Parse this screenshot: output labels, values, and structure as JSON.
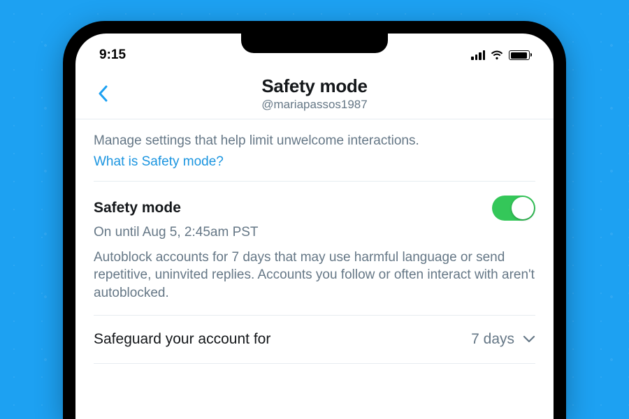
{
  "statusBar": {
    "time": "9:15"
  },
  "header": {
    "title": "Safety mode",
    "handle": "@mariapassos1987"
  },
  "intro": {
    "text": "Manage settings that help limit unwelcome interactions.",
    "link": "What is Safety mode?"
  },
  "safetyMode": {
    "label": "Safety mode",
    "enabled": true,
    "status": "On until Aug 5, 2:45am PST",
    "description": "Autoblock accounts for 7 days that may use harmful language or send repetitive, uninvited replies. Accounts you follow or often interact with aren't autoblocked."
  },
  "safeguard": {
    "label": "Safeguard your account for",
    "value": "7 days"
  },
  "colors": {
    "accent": "#1da1f2",
    "toggleOn": "#34c759",
    "textPrimary": "#14171a",
    "textSecondary": "#657786"
  }
}
